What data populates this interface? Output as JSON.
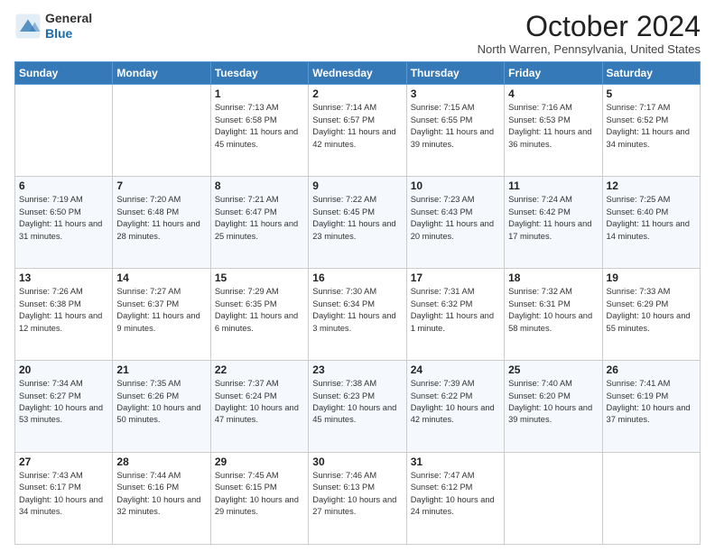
{
  "logo": {
    "general": "General",
    "blue": "Blue"
  },
  "title": "October 2024",
  "location": "North Warren, Pennsylvania, United States",
  "weekdays": [
    "Sunday",
    "Monday",
    "Tuesday",
    "Wednesday",
    "Thursday",
    "Friday",
    "Saturday"
  ],
  "weeks": [
    [
      null,
      null,
      {
        "day": 1,
        "sunrise": "7:13 AM",
        "sunset": "6:58 PM",
        "daylight": "11 hours and 45 minutes."
      },
      {
        "day": 2,
        "sunrise": "7:14 AM",
        "sunset": "6:57 PM",
        "daylight": "11 hours and 42 minutes."
      },
      {
        "day": 3,
        "sunrise": "7:15 AM",
        "sunset": "6:55 PM",
        "daylight": "11 hours and 39 minutes."
      },
      {
        "day": 4,
        "sunrise": "7:16 AM",
        "sunset": "6:53 PM",
        "daylight": "11 hours and 36 minutes."
      },
      {
        "day": 5,
        "sunrise": "7:17 AM",
        "sunset": "6:52 PM",
        "daylight": "11 hours and 34 minutes."
      }
    ],
    [
      {
        "day": 6,
        "sunrise": "7:19 AM",
        "sunset": "6:50 PM",
        "daylight": "11 hours and 31 minutes."
      },
      {
        "day": 7,
        "sunrise": "7:20 AM",
        "sunset": "6:48 PM",
        "daylight": "11 hours and 28 minutes."
      },
      {
        "day": 8,
        "sunrise": "7:21 AM",
        "sunset": "6:47 PM",
        "daylight": "11 hours and 25 minutes."
      },
      {
        "day": 9,
        "sunrise": "7:22 AM",
        "sunset": "6:45 PM",
        "daylight": "11 hours and 23 minutes."
      },
      {
        "day": 10,
        "sunrise": "7:23 AM",
        "sunset": "6:43 PM",
        "daylight": "11 hours and 20 minutes."
      },
      {
        "day": 11,
        "sunrise": "7:24 AM",
        "sunset": "6:42 PM",
        "daylight": "11 hours and 17 minutes."
      },
      {
        "day": 12,
        "sunrise": "7:25 AM",
        "sunset": "6:40 PM",
        "daylight": "11 hours and 14 minutes."
      }
    ],
    [
      {
        "day": 13,
        "sunrise": "7:26 AM",
        "sunset": "6:38 PM",
        "daylight": "11 hours and 12 minutes."
      },
      {
        "day": 14,
        "sunrise": "7:27 AM",
        "sunset": "6:37 PM",
        "daylight": "11 hours and 9 minutes."
      },
      {
        "day": 15,
        "sunrise": "7:29 AM",
        "sunset": "6:35 PM",
        "daylight": "11 hours and 6 minutes."
      },
      {
        "day": 16,
        "sunrise": "7:30 AM",
        "sunset": "6:34 PM",
        "daylight": "11 hours and 3 minutes."
      },
      {
        "day": 17,
        "sunrise": "7:31 AM",
        "sunset": "6:32 PM",
        "daylight": "11 hours and 1 minute."
      },
      {
        "day": 18,
        "sunrise": "7:32 AM",
        "sunset": "6:31 PM",
        "daylight": "10 hours and 58 minutes."
      },
      {
        "day": 19,
        "sunrise": "7:33 AM",
        "sunset": "6:29 PM",
        "daylight": "10 hours and 55 minutes."
      }
    ],
    [
      {
        "day": 20,
        "sunrise": "7:34 AM",
        "sunset": "6:27 PM",
        "daylight": "10 hours and 53 minutes."
      },
      {
        "day": 21,
        "sunrise": "7:35 AM",
        "sunset": "6:26 PM",
        "daylight": "10 hours and 50 minutes."
      },
      {
        "day": 22,
        "sunrise": "7:37 AM",
        "sunset": "6:24 PM",
        "daylight": "10 hours and 47 minutes."
      },
      {
        "day": 23,
        "sunrise": "7:38 AM",
        "sunset": "6:23 PM",
        "daylight": "10 hours and 45 minutes."
      },
      {
        "day": 24,
        "sunrise": "7:39 AM",
        "sunset": "6:22 PM",
        "daylight": "10 hours and 42 minutes."
      },
      {
        "day": 25,
        "sunrise": "7:40 AM",
        "sunset": "6:20 PM",
        "daylight": "10 hours and 39 minutes."
      },
      {
        "day": 26,
        "sunrise": "7:41 AM",
        "sunset": "6:19 PM",
        "daylight": "10 hours and 37 minutes."
      }
    ],
    [
      {
        "day": 27,
        "sunrise": "7:43 AM",
        "sunset": "6:17 PM",
        "daylight": "10 hours and 34 minutes."
      },
      {
        "day": 28,
        "sunrise": "7:44 AM",
        "sunset": "6:16 PM",
        "daylight": "10 hours and 32 minutes."
      },
      {
        "day": 29,
        "sunrise": "7:45 AM",
        "sunset": "6:15 PM",
        "daylight": "10 hours and 29 minutes."
      },
      {
        "day": 30,
        "sunrise": "7:46 AM",
        "sunset": "6:13 PM",
        "daylight": "10 hours and 27 minutes."
      },
      {
        "day": 31,
        "sunrise": "7:47 AM",
        "sunset": "6:12 PM",
        "daylight": "10 hours and 24 minutes."
      },
      null,
      null
    ]
  ]
}
